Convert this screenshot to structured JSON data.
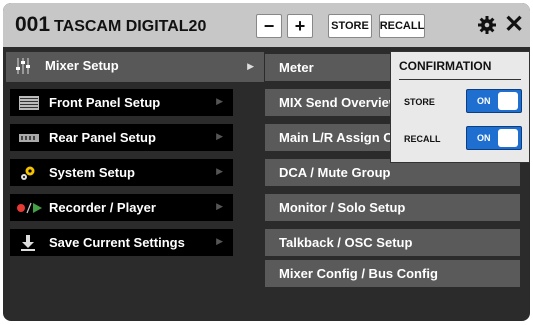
{
  "header": {
    "device_number": "001",
    "device_name": "TASCAM DIGITAL20",
    "minus_label": "−",
    "plus_label": "+",
    "store_label": "STORE",
    "recall_label": "RECALL",
    "settings_icon": "gear-icon",
    "close_label": "✕"
  },
  "menu": [
    {
      "label": "Mixer Setup",
      "icon": "mixer-faders-icon",
      "selected": true
    },
    {
      "label": "Front Panel Setup",
      "icon": "front-panel-icon"
    },
    {
      "label": "Rear Panel Setup",
      "icon": "rear-panel-icon"
    },
    {
      "label": "System Setup",
      "icon": "system-gears-icon"
    },
    {
      "label": "Recorder / Player",
      "icon": "record-play-icon"
    },
    {
      "label": "Save Current Settings",
      "icon": "download-save-icon"
    }
  ],
  "submenu": [
    {
      "label": "Meter"
    },
    {
      "label": "MIX Send Overview"
    },
    {
      "label": "Main L/R Assign Overview"
    },
    {
      "label": "DCA / Mute Group"
    },
    {
      "label": "Monitor / Solo Setup"
    },
    {
      "label": "Talkback / OSC Setup"
    },
    {
      "label": "Mixer Config / Bus Config"
    }
  ],
  "confirmation": {
    "title": "CONFIRMATION",
    "store_label": "STORE",
    "store_value": "ON",
    "recall_label": "RECALL",
    "recall_value": "ON"
  },
  "colors": {
    "accent": "#1e6fd0",
    "record_red": "#e53935",
    "play_green": "#43a047"
  }
}
